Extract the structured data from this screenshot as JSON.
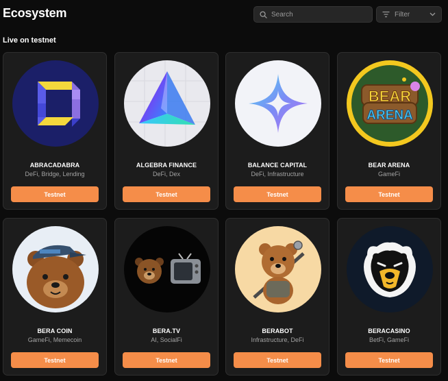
{
  "header": {
    "title": "Ecosystem",
    "search_placeholder": "Search",
    "filter_label": "Filter"
  },
  "section": {
    "title": "Live on testnet"
  },
  "button_label": "Testnet",
  "colors": {
    "accent": "#f58d49",
    "background": "#0c0c0c",
    "card": "#1c1c1c"
  },
  "projects": [
    {
      "name": "ABRACADABRA",
      "categories": "DeFi, Bridge, Lending",
      "icon": "abracadabra-logo-icon"
    },
    {
      "name": "ALGEBRA FINANCE",
      "categories": "DeFi, Dex",
      "icon": "algebra-logo-icon"
    },
    {
      "name": "BALANCE CAPITAL",
      "categories": "DeFi, Infrastructure",
      "icon": "balance-capital-logo-icon"
    },
    {
      "name": "BEAR ARENA",
      "categories": "GameFi",
      "icon": "bear-arena-logo-icon"
    },
    {
      "name": "BERA COIN",
      "categories": "GameFi, Memecoin",
      "icon": "bera-coin-logo-icon"
    },
    {
      "name": "BERA.TV",
      "categories": "AI, SocialFi",
      "icon": "bera-tv-logo-icon"
    },
    {
      "name": "BERABOT",
      "categories": "Infrastructure, DeFi",
      "icon": "berabot-logo-icon"
    },
    {
      "name": "BERACASINO",
      "categories": "BetFi, GameFi",
      "icon": "beracasino-logo-icon"
    }
  ]
}
